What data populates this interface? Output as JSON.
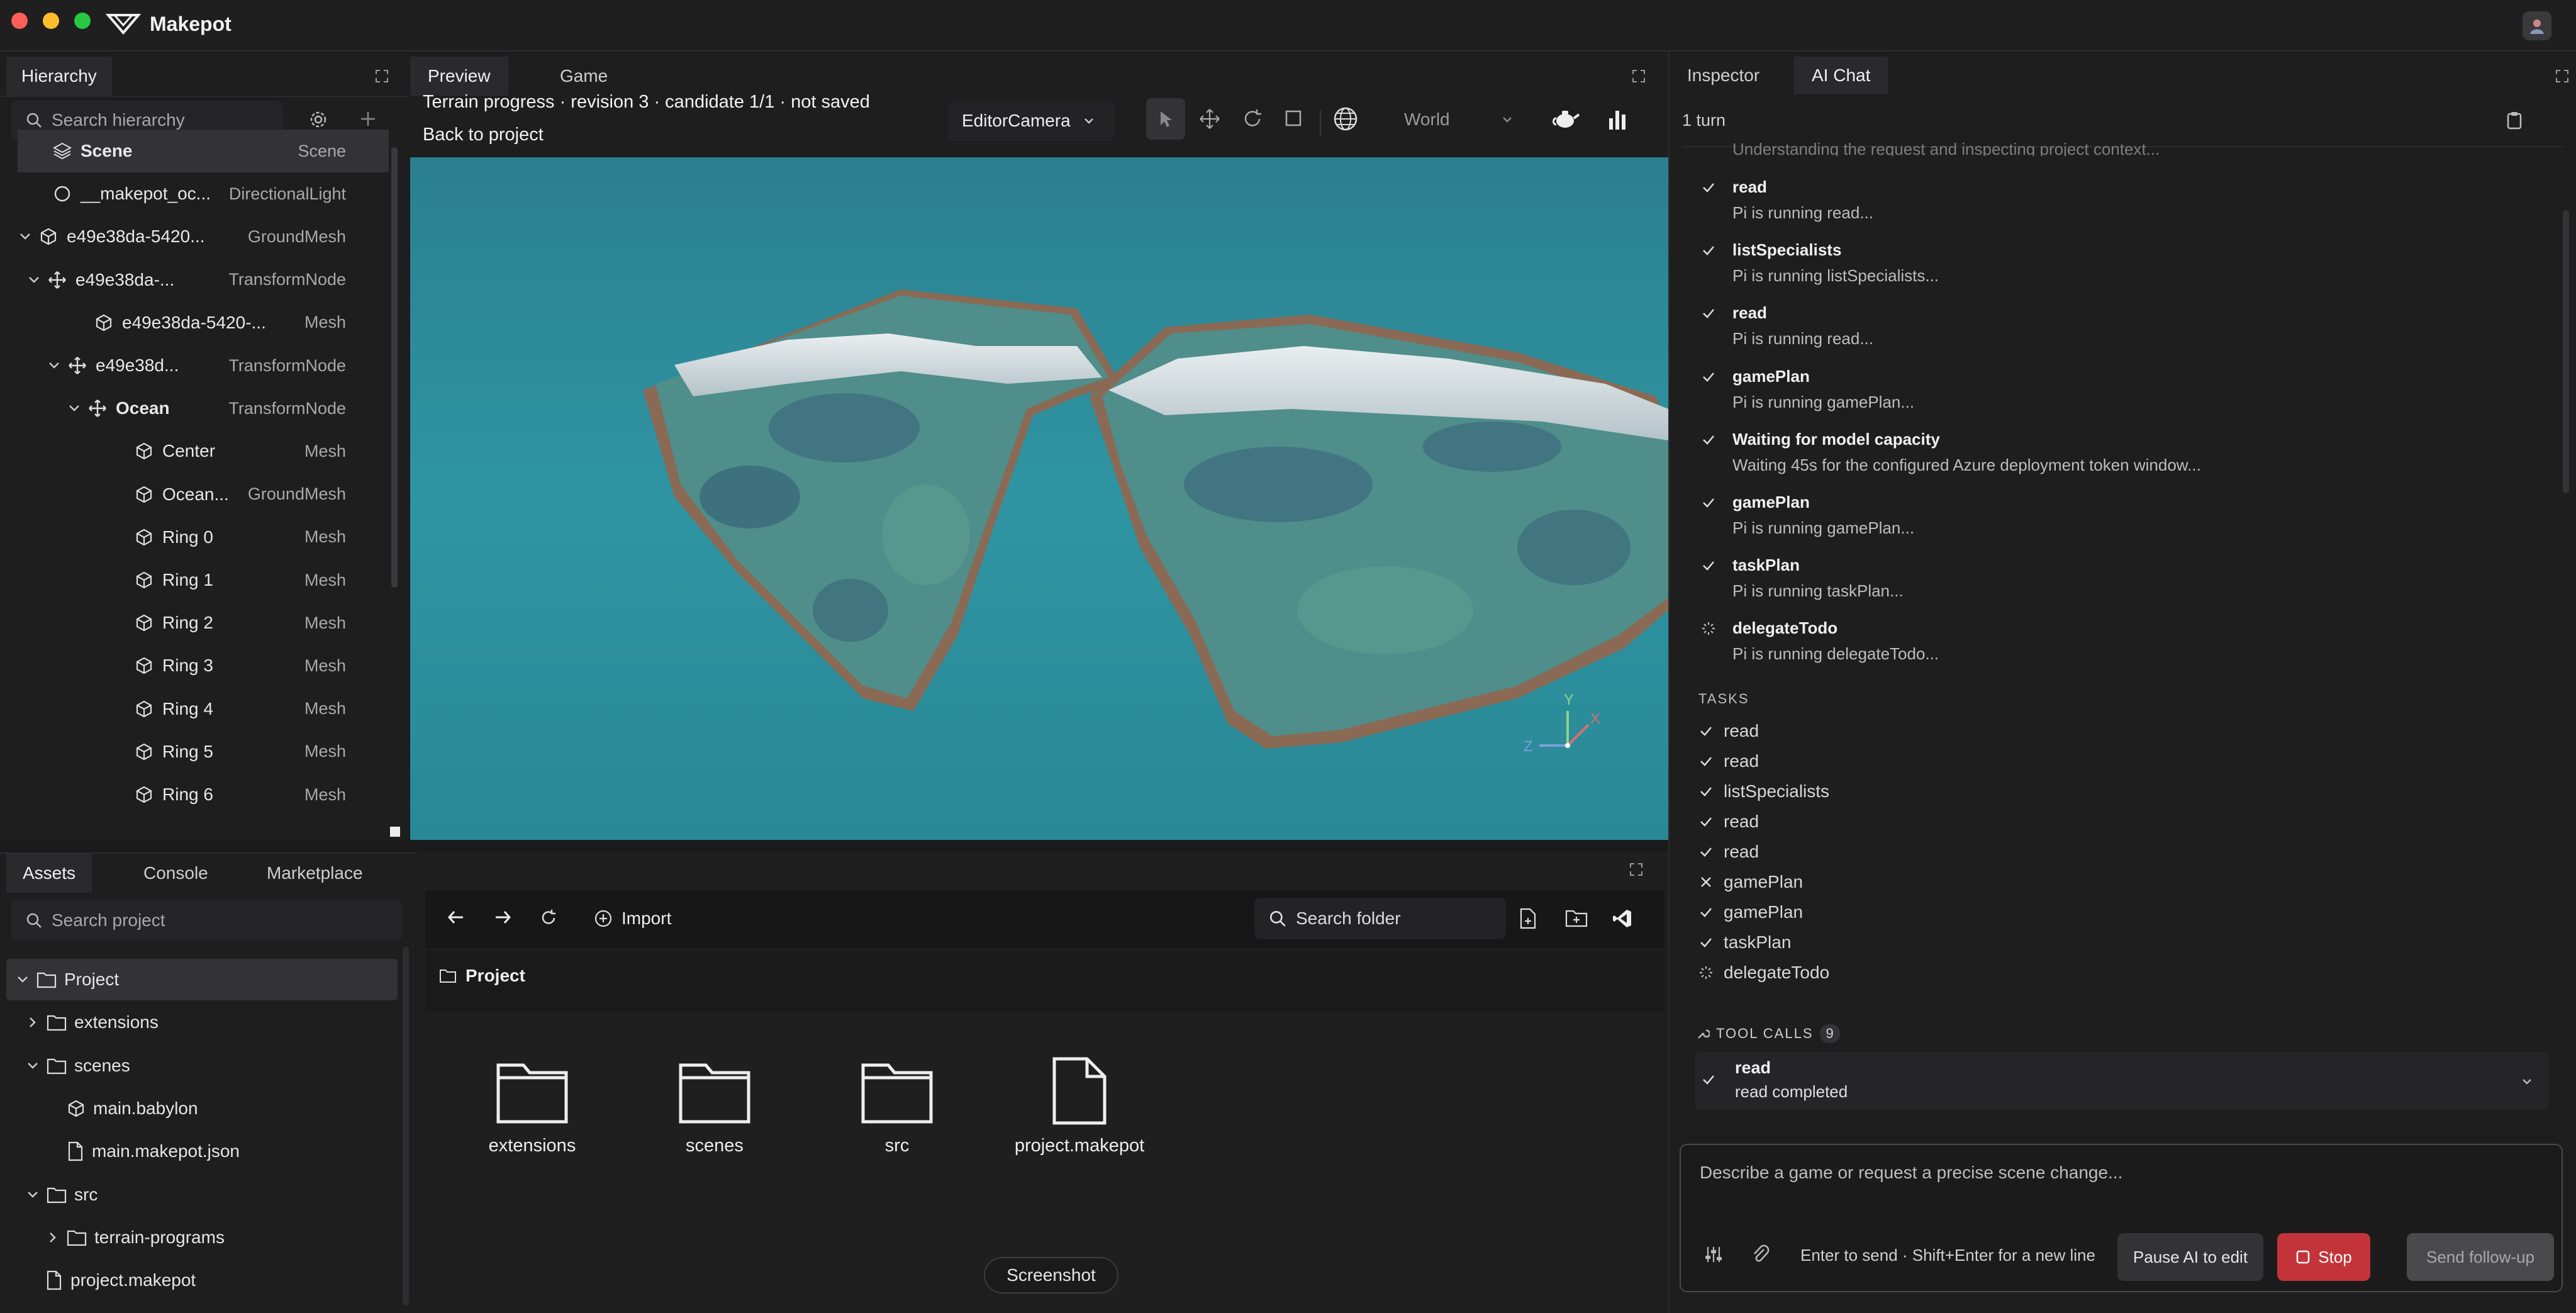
{
  "app": {
    "title": "Makepot"
  },
  "hierarchy": {
    "tab": "Hierarchy",
    "search_placeholder": "Search hierarchy",
    "rows": [
      {
        "name": "Scene",
        "kind": "Scene"
      },
      {
        "name": "__makepot_oc...",
        "kind": "DirectionalLight"
      },
      {
        "name": "e49e38da-5420...",
        "kind": "GroundMesh"
      },
      {
        "name": "e49e38da-...",
        "kind": "TransformNode"
      },
      {
        "name": "e49e38da-5420-...",
        "kind": "Mesh"
      },
      {
        "name": "e49e38d...",
        "kind": "TransformNode"
      },
      {
        "name": "Ocean",
        "kind": "TransformNode"
      },
      {
        "name": "Center",
        "kind": "Mesh"
      },
      {
        "name": "Ocean...",
        "kind": "GroundMesh"
      },
      {
        "name": "Ring 0",
        "kind": "Mesh"
      },
      {
        "name": "Ring 1",
        "kind": "Mesh"
      },
      {
        "name": "Ring 2",
        "kind": "Mesh"
      },
      {
        "name": "Ring 3",
        "kind": "Mesh"
      },
      {
        "name": "Ring 4",
        "kind": "Mesh"
      },
      {
        "name": "Ring 5",
        "kind": "Mesh"
      },
      {
        "name": "Ring 6",
        "kind": "Mesh"
      }
    ]
  },
  "preview": {
    "tabs": [
      "Preview",
      "Game"
    ],
    "status": "Terrain progress · revision 3 · candidate 1/1 · not saved",
    "back_link": "Back to project",
    "camera": "EditorCamera",
    "space": "World",
    "gizmo": {
      "x": "X",
      "y": "Y",
      "z": "Z"
    }
  },
  "right": {
    "tabs": [
      "Inspector",
      "AI Chat"
    ],
    "turns": "1 turn",
    "truncated_top": "Understanding the request and inspecting project context...",
    "steps": [
      {
        "title": "read",
        "detail": "Pi is running read..."
      },
      {
        "title": "listSpecialists",
        "detail": "Pi is running listSpecialists..."
      },
      {
        "title": "read",
        "detail": "Pi is running read..."
      },
      {
        "title": "gamePlan",
        "detail": "Pi is running gamePlan..."
      },
      {
        "title": "Waiting for model capacity",
        "detail": "Waiting 45s for the configured Azure deployment token window..."
      },
      {
        "title": "gamePlan",
        "detail": "Pi is running gamePlan..."
      },
      {
        "title": "taskPlan",
        "detail": "Pi is running taskPlan..."
      },
      {
        "title": "delegateTodo",
        "detail": "Pi is running delegateTodo..."
      }
    ],
    "tasks_header": "TASKS",
    "tasks": [
      {
        "label": "read",
        "state": "done"
      },
      {
        "label": "read",
        "state": "done"
      },
      {
        "label": "listSpecialists",
        "state": "done"
      },
      {
        "label": "read",
        "state": "done"
      },
      {
        "label": "read",
        "state": "done"
      },
      {
        "label": "gamePlan",
        "state": "failed"
      },
      {
        "label": "gamePlan",
        "state": "done"
      },
      {
        "label": "taskPlan",
        "state": "done"
      },
      {
        "label": "delegateTodo",
        "state": "running"
      }
    ],
    "tool_calls_header": "TOOL CALLS",
    "tool_calls_count": "9",
    "tool_call": {
      "title": "read",
      "detail": "read completed"
    },
    "composer": {
      "placeholder": "Describe a game or request a precise scene change...",
      "hint": "Enter to send · Shift+Enter for a new line",
      "pause_label": "Pause AI to edit",
      "stop_label": "Stop",
      "send_label": "Send follow-up"
    }
  },
  "assets": {
    "tabs": [
      "Assets",
      "Console",
      "Marketplace"
    ],
    "search_placeholder": "Search project",
    "tree": [
      {
        "name": "Project",
        "type": "folder",
        "expanded": true
      },
      {
        "name": "extensions",
        "type": "folder",
        "expanded": false
      },
      {
        "name": "scenes",
        "type": "folder",
        "expanded": true
      },
      {
        "name": "main.babylon",
        "type": "mesh"
      },
      {
        "name": "main.makepot.json",
        "type": "file"
      },
      {
        "name": "src",
        "type": "folder",
        "expanded": true
      },
      {
        "name": "terrain-programs",
        "type": "folder",
        "expanded": false
      },
      {
        "name": "project.makepot",
        "type": "file"
      }
    ]
  },
  "browser": {
    "import_label": "Import",
    "search_placeholder": "Search folder",
    "breadcrumb": "Project",
    "items": [
      {
        "name": "extensions",
        "type": "folder"
      },
      {
        "name": "scenes",
        "type": "folder"
      },
      {
        "name": "src",
        "type": "folder"
      },
      {
        "name": "project.makepot",
        "type": "file"
      }
    ],
    "tooltip": "Screenshot"
  },
  "colors": {
    "accent_red": "#c4333a",
    "ocean": "#2f8f9c",
    "panel": "#1e1e1f"
  }
}
